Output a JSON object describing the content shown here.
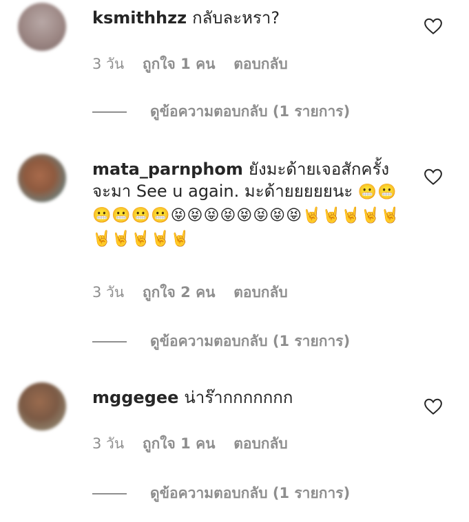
{
  "comments": [
    {
      "username": "ksmithhzz",
      "text": "กลับละหรา?",
      "emojis": "",
      "time": "3 วัน",
      "likes": "ถูกใจ 1 คน",
      "reply": "ตอบกลับ",
      "view_replies": "ดูข้อความตอบกลับ (1 รายการ)"
    },
    {
      "username": "mata_parnphom",
      "text": "ยังมะด้ายเจอสักครั้ง จะมา See u again. มะด้ายยยยยนะ",
      "emojis": "😬😬😬😬😬😬😝😝😝😝😝😝😝😝🤘🤘🤘🤘🤘🤘🤘🤘🤘🤘",
      "time": "3 วัน",
      "likes": "ถูกใจ 2 คน",
      "reply": "ตอบกลับ",
      "view_replies": "ดูข้อความตอบกลับ (1 รายการ)"
    },
    {
      "username": "mggegee",
      "text": "น่าร๊ากกกกกกก",
      "emojis": "",
      "time": "3 วัน",
      "likes": "ถูกใจ 1 คน",
      "reply": "ตอบกลับ",
      "view_replies": "ดูข้อความตอบกลับ (1 รายการ)"
    }
  ],
  "icons": {
    "like": "heart-outline-icon",
    "avatar": "blurred-profile-photo"
  }
}
